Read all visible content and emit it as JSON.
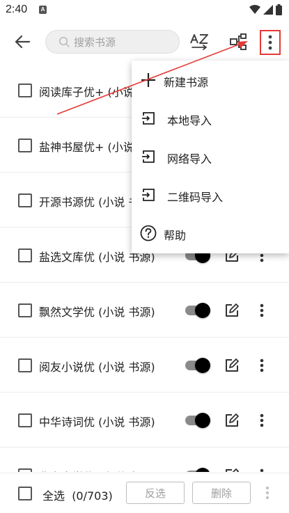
{
  "status_bar": {
    "time": "2:40",
    "notification_letter": "A",
    "icons": [
      "wifi-icon",
      "signal-icon",
      "battery-icon"
    ]
  },
  "toolbar": {
    "back_icon": "arrow-left-icon",
    "search_placeholder": "搜索书源",
    "sort_icon": "sort-az-icon",
    "group_icon": "group-icon",
    "more_icon": "more-vertical-icon"
  },
  "sources": [
    {
      "label": "阅读库子优+ (小说"
    },
    {
      "label": "盐神书屋优+ (小说"
    },
    {
      "label": "开源书源优 (小说 书"
    },
    {
      "label": "盐选文库优 (小说 书源)"
    },
    {
      "label": "飘然文学优 (小说 书源)"
    },
    {
      "label": "阅友小说优 (小说 书源)"
    },
    {
      "label": "中华诗词优 (小说 书源)"
    },
    {
      "label": "华书文学优 (小说 书源)"
    }
  ],
  "menu": {
    "items": [
      {
        "label": "新建书源",
        "icon": "plus-icon"
      },
      {
        "label": "本地导入",
        "icon": "import-icon"
      },
      {
        "label": "网络导入",
        "icon": "import-icon"
      },
      {
        "label": "二维码导入",
        "icon": "import-icon"
      },
      {
        "label": "帮助",
        "icon": "help-icon"
      }
    ]
  },
  "bottom_bar": {
    "select_all_label": "全选",
    "count_label": "(0/703)",
    "invert_label": "反选",
    "delete_label": "删除"
  },
  "colors": {
    "annotation_red": "#e53935",
    "switch_thumb": "#000000",
    "switch_track": "#8a8a8a"
  }
}
